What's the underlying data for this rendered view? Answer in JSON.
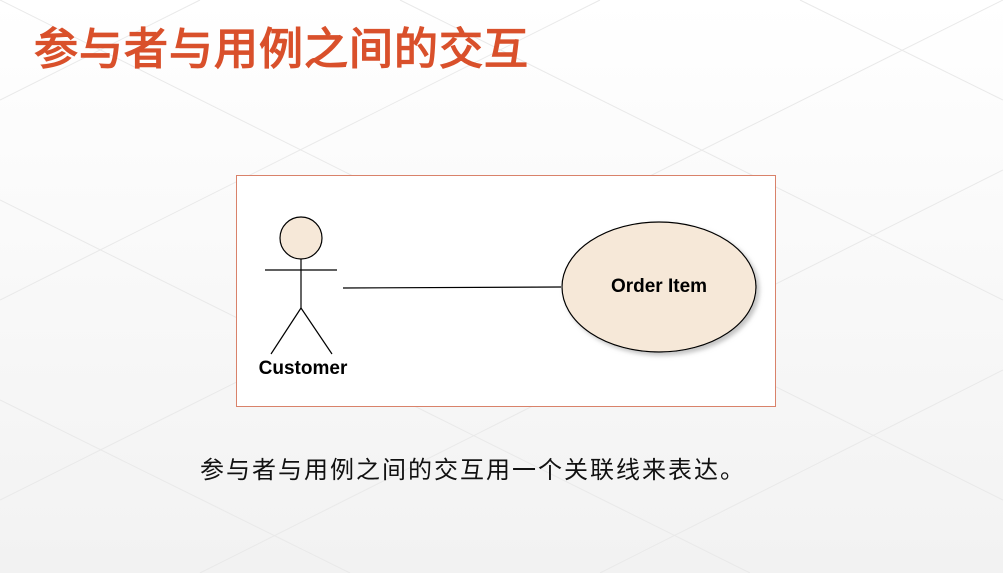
{
  "slide": {
    "title": "参与者与用例之间的交互",
    "caption": "参与者与用例之间的交互用一个关联线来表达。"
  },
  "diagram": {
    "actor": {
      "name": "Customer"
    },
    "use_case": {
      "name": "Order Item"
    }
  },
  "colors": {
    "title": "#d9502b",
    "frame_border": "#d9826a",
    "actor_head_fill": "#f6e8d8",
    "use_case_fill": "#f6e8d8"
  }
}
